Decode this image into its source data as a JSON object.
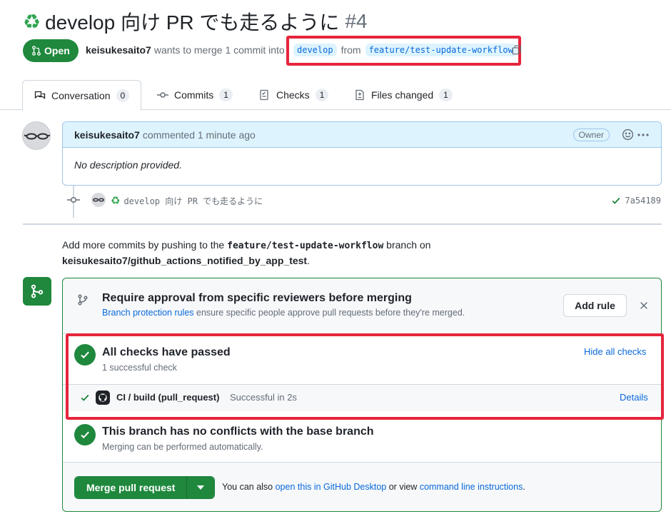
{
  "pr": {
    "title": "develop 向け PR でも走るように",
    "number": "#4",
    "state": "Open",
    "author": "keisukesaito7",
    "merge_text": "wants to merge 1 commit into",
    "base_branch": "develop",
    "from_text": "from",
    "head_branch": "feature/test-update-workflow"
  },
  "tabs": [
    {
      "label": "Conversation",
      "count": "0"
    },
    {
      "label": "Commits",
      "count": "1"
    },
    {
      "label": "Checks",
      "count": "1"
    },
    {
      "label": "Files changed",
      "count": "1"
    }
  ],
  "comment": {
    "author": "keisukesaito7",
    "meta": "commented 1 minute ago",
    "badge": "Owner",
    "body": "No description provided."
  },
  "commit": {
    "message": "develop 向け PR でも走るように",
    "sha": "7a54189"
  },
  "push_info": {
    "prefix": "Add more commits by pushing to the",
    "branch": "feature/test-update-workflow",
    "middle": "branch on",
    "repo": "keisukesaito7/github_actions_notified_by_app_test",
    "suffix": "."
  },
  "protection": {
    "title": "Require approval from specific reviewers before merging",
    "link": "Branch protection rules",
    "desc": "ensure specific people approve pull requests before they're merged.",
    "add_rule": "Add rule"
  },
  "checks": {
    "title": "All checks have passed",
    "subtitle": "1 successful check",
    "hide_link": "Hide all checks",
    "item_name": "CI / build (pull_request)",
    "item_status": "Successful in 2s",
    "details": "Details"
  },
  "conflicts": {
    "title": "This branch has no conflicts with the base branch",
    "subtitle": "Merging can be performed automatically."
  },
  "merge": {
    "button": "Merge pull request",
    "also_text": "You can also",
    "desktop_link": "open this in GitHub Desktop",
    "or_view": "or view",
    "cli_link": "command line instructions",
    "end": "."
  },
  "colors": {
    "accent_green": "#1f883d",
    "link_blue": "#0969da",
    "highlight_red": "#e5253c"
  }
}
